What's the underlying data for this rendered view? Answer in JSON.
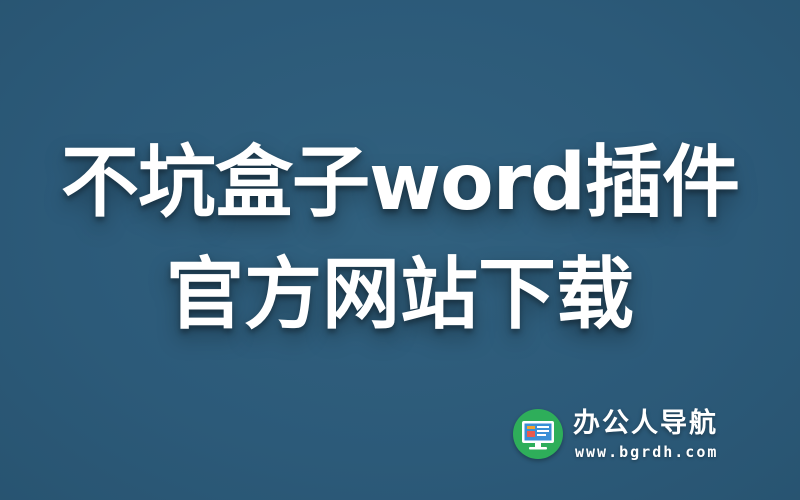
{
  "headline": {
    "line1": "不坑盒子word插件",
    "line2": "官方网站下载"
  },
  "brand": {
    "name": "办公人导航",
    "url": "www.bgrdh.com",
    "logo_icon": "monitor-icon"
  },
  "colors": {
    "background": "#2d5b7b",
    "text": "#ffffff",
    "logo_circle": "#2eae5a",
    "logo_screen": "#3a8fd6",
    "logo_accent": "#f0a030"
  }
}
